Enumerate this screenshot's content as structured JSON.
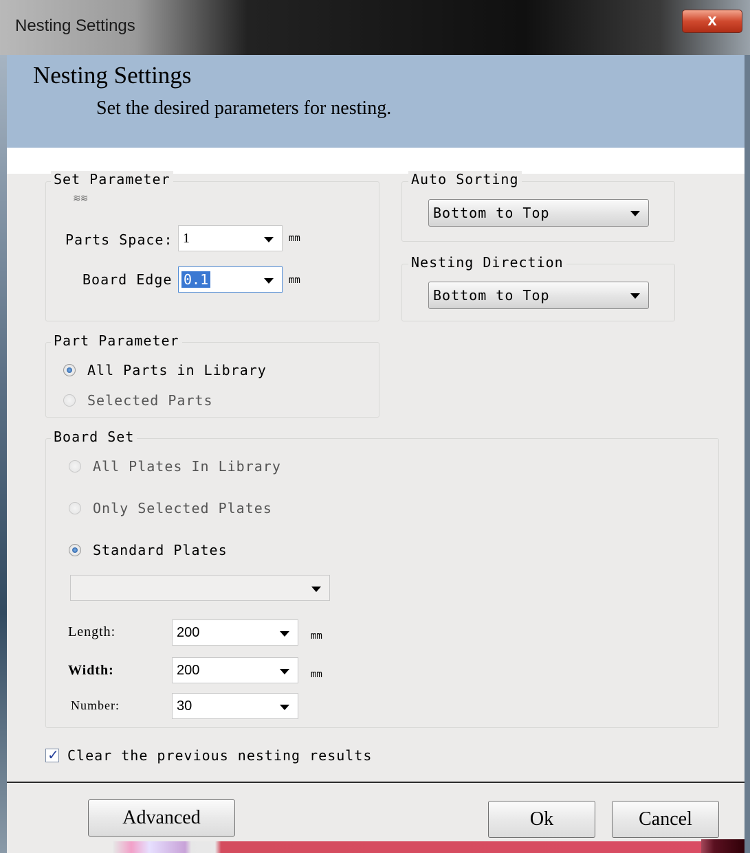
{
  "window": {
    "title": "Nesting Settings",
    "close_glyph": "x"
  },
  "header": {
    "title": "Nesting Settings",
    "subtitle": "Set the desired parameters for nesting."
  },
  "set_parameter": {
    "legend": "Set Parameter",
    "parts_space_label": "Parts Space:",
    "parts_space_value": "1",
    "parts_space_unit": "mm",
    "board_edge_label": "Board Edge",
    "board_edge_value": "0.1",
    "board_edge_unit": "mm"
  },
  "auto_sorting": {
    "legend": "Auto Sorting",
    "value": "Bottom to Top"
  },
  "nesting_direction": {
    "legend": "Nesting Direction",
    "value": "Bottom to Top"
  },
  "part_parameter": {
    "legend": "Part Parameter",
    "options": [
      {
        "label": "All Parts in Library",
        "selected": true,
        "enabled": true
      },
      {
        "label": "Selected Parts",
        "selected": false,
        "enabled": false
      }
    ]
  },
  "board_set": {
    "legend": "Board Set",
    "options": [
      {
        "label": "All Plates In Library",
        "selected": false,
        "enabled": false
      },
      {
        "label": "Only Selected Plates",
        "selected": false,
        "enabled": false
      },
      {
        "label": "Standard Plates",
        "selected": true,
        "enabled": true
      }
    ],
    "plate_select_value": "",
    "length_label": "Length:",
    "length_value": "200",
    "length_unit": "mm",
    "width_label": "Width:",
    "width_value": "200",
    "width_unit": "mm",
    "number_label": "Number:",
    "number_value": "30"
  },
  "clear_results": {
    "label": "Clear the previous nesting results",
    "checked": true,
    "check_glyph": "✓"
  },
  "buttons": {
    "advanced": "Advanced",
    "ok": "Ok",
    "cancel": "Cancel"
  },
  "icons": [
    "close-icon",
    "dropdown-arrow-icon",
    "radio-icon",
    "checkbox-icon"
  ]
}
